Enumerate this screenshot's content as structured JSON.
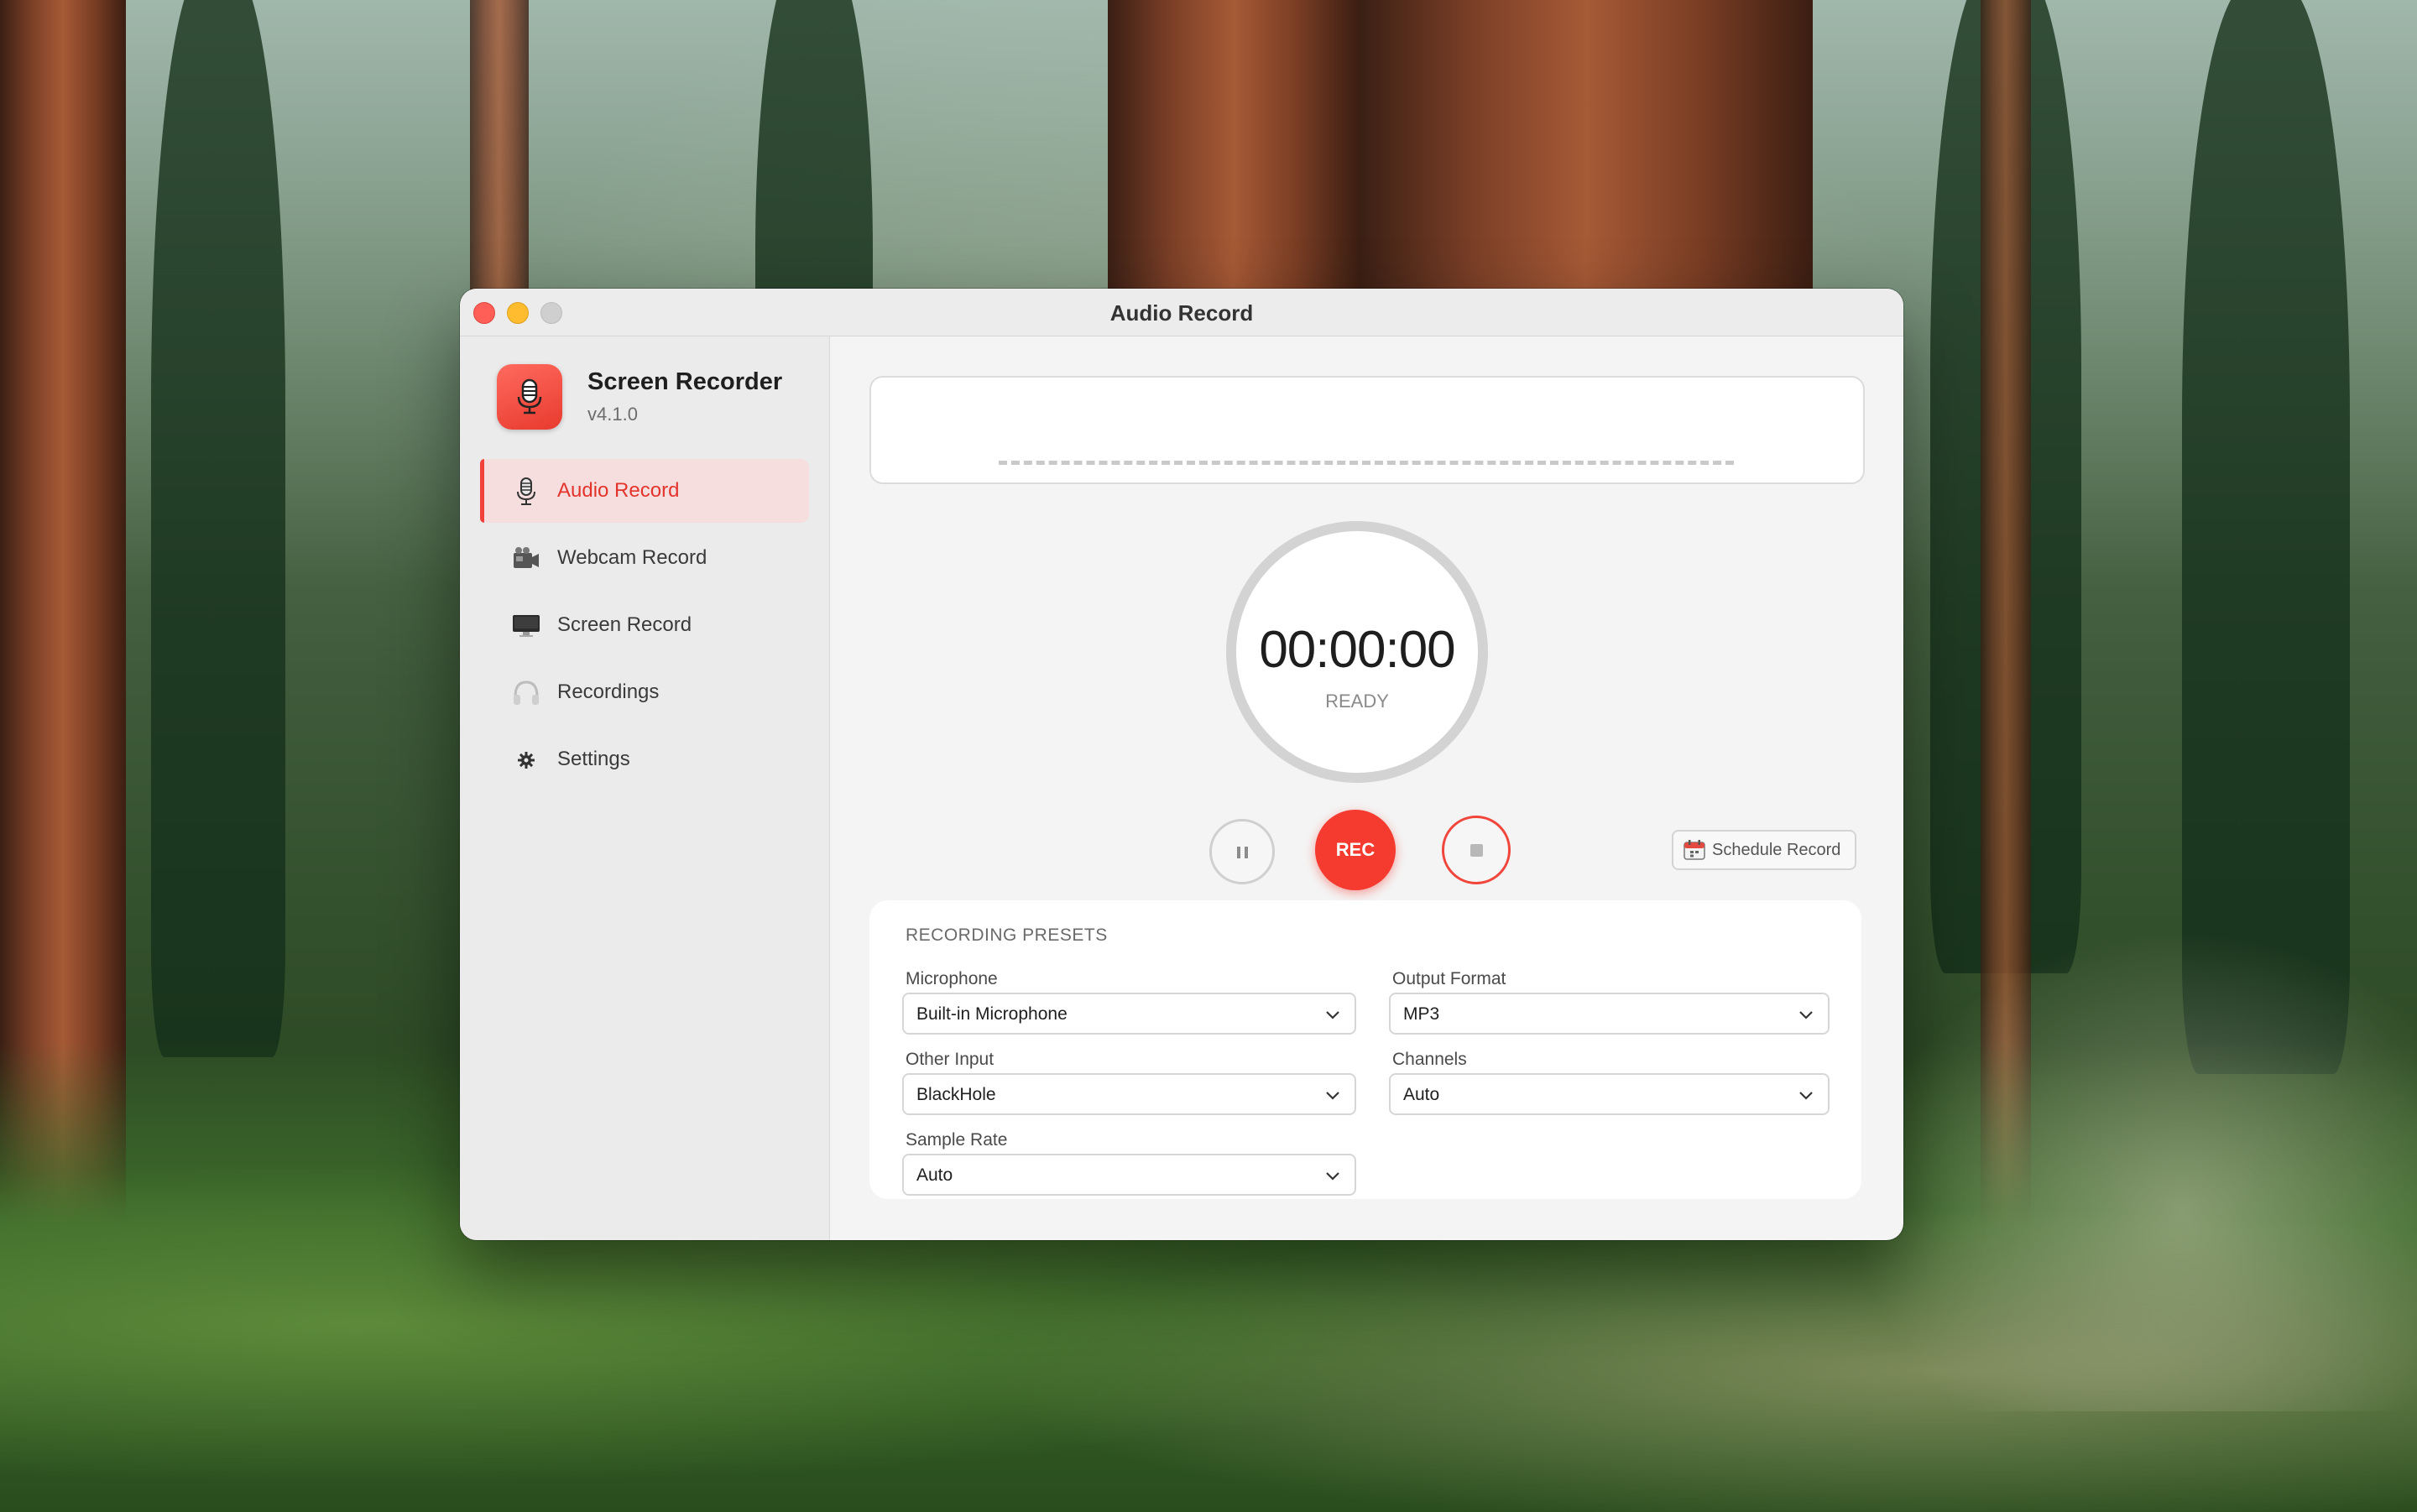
{
  "window": {
    "title": "Audio Record"
  },
  "app": {
    "name": "Screen Recorder",
    "version": "v4.1.0",
    "icon": "microphone-icon"
  },
  "sidebar": {
    "items": [
      {
        "label": "Audio Record",
        "icon": "microphone-icon",
        "active": true
      },
      {
        "label": "Webcam Record",
        "icon": "video-camera-icon",
        "active": false
      },
      {
        "label": "Screen Record",
        "icon": "monitor-icon",
        "active": false
      },
      {
        "label": "Recordings",
        "icon": "headphones-icon",
        "active": false
      },
      {
        "label": "Settings",
        "icon": "gear-icon",
        "active": false
      }
    ]
  },
  "timer": {
    "time": "00:00:00",
    "status": "READY"
  },
  "controls": {
    "rec_label": "REC",
    "schedule_label": "Schedule Record"
  },
  "presets": {
    "title": "RECORDING PRESETS",
    "microphone": {
      "label": "Microphone",
      "value": "Built-in Microphone"
    },
    "output_format": {
      "label": "Output Format",
      "value": "MP3"
    },
    "other_input": {
      "label": "Other Input",
      "value": "BlackHole"
    },
    "channels": {
      "label": "Channels",
      "value": "Auto"
    },
    "sample_rate": {
      "label": "Sample Rate",
      "value": "Auto"
    }
  },
  "colors": {
    "accent": "#f53b30",
    "active_bg": "#f7dede"
  }
}
